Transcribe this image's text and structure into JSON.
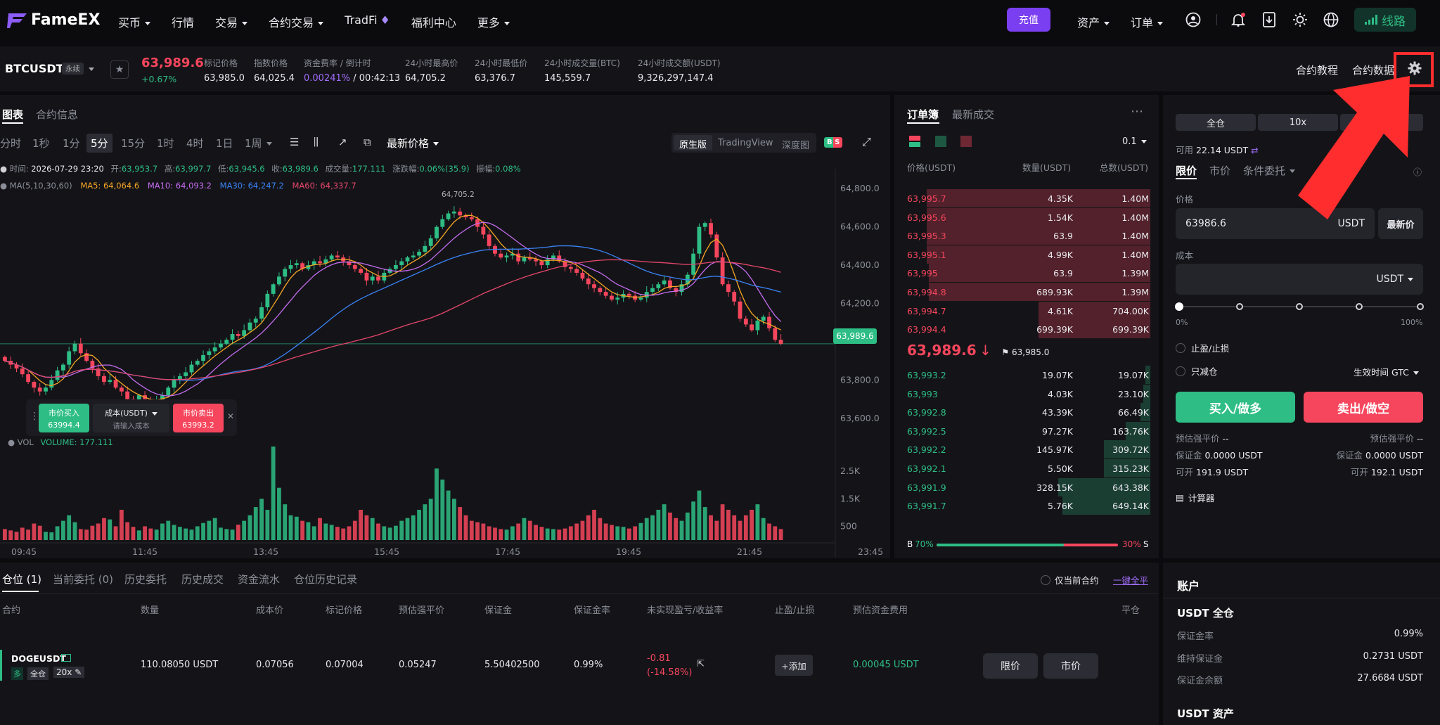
{
  "nav": {
    "brand": "FameEX",
    "items": [
      "买币",
      "行情",
      "交易",
      "合约交易",
      "TradFi",
      "福利中心",
      "更多"
    ],
    "deposit": "充值",
    "assets": "资产",
    "orders": "订单",
    "route": "线路"
  },
  "ticker": {
    "symbol": "BTCUSDT",
    "badge": "永续",
    "price": "63,989.6",
    "change": "+0.67%",
    "mark_label": "标记价格",
    "mark": "63,985.0",
    "index_label": "指数价格",
    "index": "64,025.4",
    "funding_label": "资金费率 / 倒计时",
    "funding": "0.00241%",
    "countdown": "/ 00:42:13",
    "high_label": "24小时最高价",
    "high": "64,705.2",
    "low_label": "24小时最低价",
    "low": "63,376.7",
    "volbtc_label": "24小时成交量(BTC)",
    "volbtc": "145,559.7",
    "volusdt_label": "24小时成交额(USDT)",
    "volusdt": "9,326,297,147.4",
    "tutorial": "合约教程",
    "data": "合约数据"
  },
  "chart_panel": {
    "tab_chart": "图表",
    "tab_info": "合约信息",
    "timeframes": [
      "分时",
      "1秒",
      "1分",
      "5分",
      "15分",
      "1时",
      "4时",
      "1日",
      "1周"
    ],
    "active_tf": "5分",
    "price_type": "最新价格",
    "views": [
      "原生版",
      "TradingView",
      "深度图"
    ],
    "bs_badge": "B S",
    "info": {
      "time_label": "时间:",
      "time": "2026-07-29 23:20",
      "open_label": "开:",
      "open": "63,953.7",
      "high_label": "高:",
      "high": "63,997.7",
      "low_label": "低:",
      "low": "63,945.6",
      "close_label": "收:",
      "close": "63,989.6",
      "vol_label": "成交量:",
      "vol": "177.111",
      "chg_label": "涨跌幅:",
      "chg": "0.06%(35.9)",
      "amp_label": "振幅:",
      "amp": "0.08%"
    },
    "ma": {
      "label": "MA(5,10,30,60)",
      "ma5": "MA5: 64,064.6",
      "ma10": "MA10: 64,093.2",
      "ma30": "MA30: 64,247.2",
      "ma60": "MA60: 64,337.7",
      "ma5_color": "#f5a623",
      "ma10_color": "#c56cf0",
      "ma30_color": "#3b82f6",
      "ma60_color": "#e5466b"
    },
    "vol_title": "VOL",
    "vol_value": "VOLUME: 177.111",
    "high_marker": "64,705.2",
    "current_tag": "63,989.6",
    "quick": {
      "buy_label": "市价买入",
      "buy_price": "63994.4",
      "cost_label": "成本(USDT)",
      "cost_placeholder": "请输入成本",
      "sell_label": "市价卖出",
      "sell_price": "63993.2"
    }
  },
  "chart_data": {
    "type": "candlestick",
    "y_ticks": [
      "64,800.0",
      "64,600.0",
      "64,400.0",
      "64,200.0",
      "63,800.0",
      "63,600.0"
    ],
    "ylim": [
      63500,
      64830
    ],
    "x_ticks": [
      "09:45",
      "11:45",
      "13:45",
      "15:45",
      "17:45",
      "19:45",
      "21:45",
      "23:45"
    ],
    "vol_ticks": [
      "2.5K",
      "1.5K",
      "500"
    ],
    "vol_max": 3400,
    "closes": [
      63900,
      63880,
      63860,
      63830,
      63790,
      63760,
      63740,
      63760,
      63800,
      63850,
      63880,
      63950,
      63990,
      63940,
      63900,
      63860,
      63820,
      63790,
      63800,
      63760,
      63740,
      63700,
      63690,
      63720,
      63700,
      63680,
      63690,
      63720,
      63760,
      63800,
      63820,
      63840,
      63880,
      63900,
      63930,
      63950,
      63970,
      63990,
      64010,
      64040,
      64030,
      64060,
      64100,
      64120,
      64180,
      64250,
      64300,
      64340,
      64380,
      64400,
      64410,
      64380,
      64400,
      64420,
      64410,
      64430,
      64450,
      64440,
      64420,
      64400,
      64380,
      64360,
      64320,
      64340,
      64320,
      64360,
      64380,
      64400,
      64420,
      64440,
      64450,
      64470,
      64500,
      64540,
      64600,
      64640,
      64670,
      64680,
      64660,
      64650,
      64640,
      64600,
      64560,
      64500,
      64460,
      64440,
      64450,
      64460,
      64420,
      64440,
      64430,
      64420,
      64400,
      64430,
      64450,
      64420,
      64390,
      64380,
      64360,
      64330,
      64300,
      64280,
      64260,
      64240,
      64220,
      64230,
      64250,
      64240,
      64220,
      64230,
      64260,
      64280,
      64300,
      64320,
      64280,
      64260,
      64300,
      64350,
      64460,
      64600,
      64620,
      64560,
      64440,
      64300,
      64260,
      64210,
      64120,
      64090,
      64060,
      64110,
      64130,
      64070,
      64010,
      63989
    ],
    "volumes": [
      400,
      350,
      300,
      450,
      380,
      600,
      520,
      300,
      280,
      500,
      700,
      900,
      650,
      400,
      380,
      520,
      600,
      800,
      750,
      500,
      1100,
      650,
      480,
      350,
      500,
      420,
      380,
      600,
      700,
      550,
      480,
      420,
      380,
      500,
      620,
      700,
      800,
      450,
      400,
      380,
      560,
      700,
      900,
      1200,
      1500,
      1100,
      3400,
      1900,
      1300,
      900,
      850,
      700,
      650,
      500,
      800,
      600,
      550,
      480,
      420,
      500,
      700,
      1100,
      900,
      800,
      600,
      500,
      450,
      520,
      700,
      800,
      900,
      1100,
      1300,
      1500,
      2600,
      2200,
      1800,
      1500,
      1200,
      900,
      700,
      650,
      600,
      500,
      450,
      400,
      380,
      500,
      600,
      800,
      700,
      550,
      480,
      420,
      400,
      380,
      420,
      500,
      600,
      700,
      900,
      1100,
      800,
      600,
      550,
      500,
      480,
      420,
      500,
      620,
      800,
      900,
      1100,
      1300,
      1000,
      800,
      700,
      1000,
      1400,
      1800,
      1200,
      900,
      700,
      1300,
      1100,
      900,
      700,
      900,
      1100,
      1300,
      800,
      600,
      500,
      400
    ]
  },
  "orderbook": {
    "tab_book": "订单簿",
    "tab_trades": "最新成交",
    "precision": "0.1",
    "col_price": "价格(USDT)",
    "col_qty": "数量(USDT)",
    "col_total": "总数(USDT)",
    "asks": [
      {
        "p": "63,995.7",
        "q": "4.35K",
        "t": "1.40M",
        "d": 0.92
      },
      {
        "p": "63,995.6",
        "q": "1.54K",
        "t": "1.40M",
        "d": 0.92
      },
      {
        "p": "63,995.3",
        "q": "63.9",
        "t": "1.40M",
        "d": 0.92
      },
      {
        "p": "63,995.1",
        "q": "4.99K",
        "t": "1.40M",
        "d": 0.92
      },
      {
        "p": "63,995",
        "q": "63.9",
        "t": "1.39M",
        "d": 0.91
      },
      {
        "p": "63,994.8",
        "q": "689.93K",
        "t": "1.39M",
        "d": 0.91
      },
      {
        "p": "63,994.7",
        "q": "4.61K",
        "t": "704.00K",
        "d": 0.46
      },
      {
        "p": "63,994.4",
        "q": "699.39K",
        "t": "699.39K",
        "d": 0.46
      }
    ],
    "last": "63,989.6",
    "last_arrow": "↓",
    "mark_flag": "63,985.0",
    "bids": [
      {
        "p": "63,993.2",
        "q": "19.07K",
        "t": "19.07K",
        "d": 0.02
      },
      {
        "p": "63,993",
        "q": "4.03K",
        "t": "23.10K",
        "d": 0.03
      },
      {
        "p": "63,992.8",
        "q": "43.39K",
        "t": "66.49K",
        "d": 0.04
      },
      {
        "p": "63,992.5",
        "q": "97.27K",
        "t": "163.76K",
        "d": 0.1
      },
      {
        "p": "63,992.2",
        "q": "145.97K",
        "t": "309.72K",
        "d": 0.19
      },
      {
        "p": "63,992.1",
        "q": "5.50K",
        "t": "315.23K",
        "d": 0.19
      },
      {
        "p": "63,991.9",
        "q": "328.15K",
        "t": "643.38K",
        "d": 0.38
      },
      {
        "p": "63,991.7",
        "q": "5.76K",
        "t": "649.14K",
        "d": 0.36
      }
    ],
    "ratio_b_label": "B",
    "ratio_b": "70%",
    "ratio_s": "30%",
    "ratio_s_label": "S",
    "ratio_buy": 0.7
  },
  "trade": {
    "margin_mode": "全仓",
    "leverage": "10x",
    "available_label": "可用",
    "available": "22.14 USDT",
    "tab_limit": "限价",
    "tab_market": "市价",
    "tab_cond": "条件委托",
    "price_label": "价格",
    "price_value": "63986.6",
    "price_unit": "USDT",
    "latest_btn": "最新价",
    "cost_label": "成本",
    "cost_unit": "USDT",
    "slider_min": "0%",
    "slider_max": "100%",
    "tpsl": "止盈/止损",
    "reduce_only": "只减仓",
    "tif_label": "生效时间",
    "tif": "GTC",
    "buy_btn": "买入/做多",
    "sell_btn": "卖出/做空",
    "liq_label": "预估强平价",
    "liq_buy": "--",
    "liq_sell": "--",
    "margin_label": "保证金",
    "margin_buy": "0.0000 USDT",
    "margin_sell": "0.0000 USDT",
    "open_label": "可开",
    "open_buy": "191.9 USDT",
    "open_sell": "192.1 USDT",
    "calculator": "计算器"
  },
  "positions": {
    "tabs": [
      "仓位 (1)",
      "当前委托 (0)",
      "历史委托",
      "历史成交",
      "资金流水",
      "仓位历史记录"
    ],
    "only_current": "仅当前合约",
    "close_all": "一键全平",
    "headers": [
      "合约",
      "数量",
      "成本价",
      "标记价格",
      "预估强平价",
      "保证金",
      "保证金率",
      "未实现盈亏/收益率",
      "止盈/止损",
      "预估资金费用",
      "平仓"
    ],
    "row": {
      "symbol": "DOGEUSDT",
      "side": "多",
      "mode": "全仓",
      "lev": "20x",
      "qty": "110.08050 USDT",
      "cost": "0.07056",
      "mark": "0.07004",
      "liq": "0.05247",
      "margin": "5.50402500",
      "margin_rate": "0.99%",
      "pnl": "-0.81",
      "pnl_rate": "(-14.58%)",
      "add": "+添加",
      "funding": "0.00045 USDT",
      "limit_btn": "限价",
      "market_btn": "市价"
    }
  },
  "account": {
    "title": "账户",
    "section": "USDT 全仓",
    "rows": [
      {
        "label": "保证金率",
        "value": "0.99%"
      },
      {
        "label": "维持保证金",
        "value": "0.2731 USDT"
      },
      {
        "label": "保证金余额",
        "value": "27.6684 USDT"
      }
    ],
    "assets": "USDT 资产"
  },
  "colors": {
    "up": "#2ebd85",
    "down": "#f6465d",
    "accent": "#7b3ff2",
    "arrow": "#ff2d2d"
  }
}
